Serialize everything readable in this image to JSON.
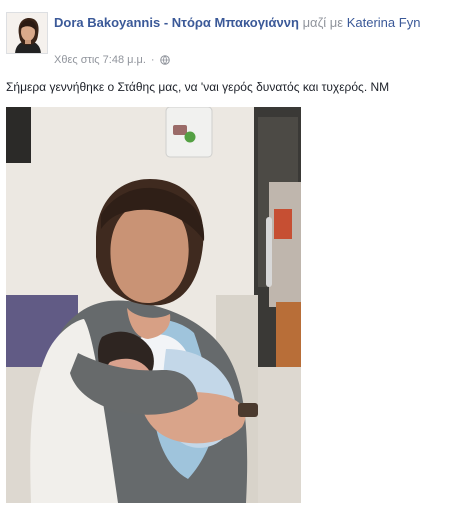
{
  "post": {
    "author": "Dora Bakoyannis - Ντόρα Μπακογιάννη",
    "with_label": "μαζί με",
    "tagged_name": "Katerina Fyn",
    "timestamp": "Χθες στις 7:48 μ.μ.",
    "separator": "·",
    "privacy_icon": "globe-icon",
    "text": "Σήμερα γεννήθηκε ο Στάθης μας, να 'ναι γερός δυνατός και τυχερός. ΝΜ"
  },
  "colors": {
    "author_link": "#3b5998",
    "meta_text": "#90949c",
    "body_text": "#1d2129"
  }
}
